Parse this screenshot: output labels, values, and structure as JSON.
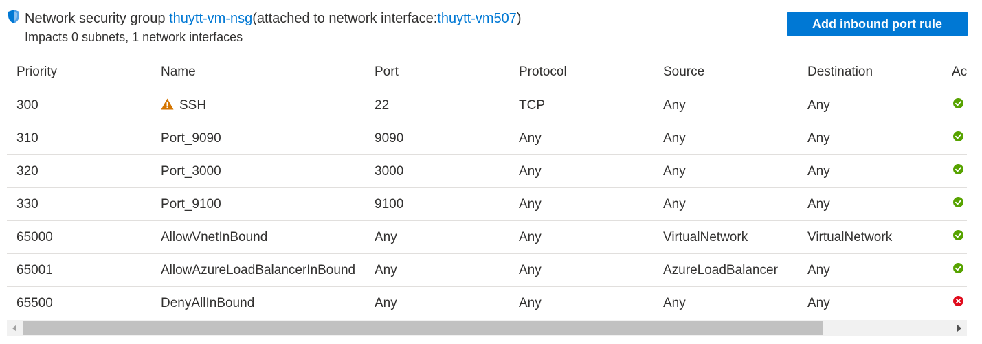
{
  "nsg": {
    "prefix": "Network security group ",
    "name": "thuytt-vm-nsg",
    "attached_prefix": " (attached to network interface: ",
    "interface": "thuytt-vm507",
    "attached_suffix": ")",
    "impacts": "Impacts 0 subnets, 1 network interfaces"
  },
  "add_button_label": "Add inbound port rule",
  "columns": [
    "Priority",
    "Name",
    "Port",
    "Protocol",
    "Source",
    "Destination",
    "Ac"
  ],
  "rules": [
    {
      "priority": "300",
      "name": "SSH",
      "warning": true,
      "port": "22",
      "protocol": "TCP",
      "source": "Any",
      "destination": "Any",
      "action": "allow"
    },
    {
      "priority": "310",
      "name": "Port_9090",
      "warning": false,
      "port": "9090",
      "protocol": "Any",
      "source": "Any",
      "destination": "Any",
      "action": "allow"
    },
    {
      "priority": "320",
      "name": "Port_3000",
      "warning": false,
      "port": "3000",
      "protocol": "Any",
      "source": "Any",
      "destination": "Any",
      "action": "allow"
    },
    {
      "priority": "330",
      "name": "Port_9100",
      "warning": false,
      "port": "9100",
      "protocol": "Any",
      "source": "Any",
      "destination": "Any",
      "action": "allow"
    },
    {
      "priority": "65000",
      "name": "AllowVnetInBound",
      "warning": false,
      "port": "Any",
      "protocol": "Any",
      "source": "VirtualNetwork",
      "destination": "VirtualNetwork",
      "action": "allow"
    },
    {
      "priority": "65001",
      "name": "AllowAzureLoadBalancerInBound",
      "warning": false,
      "port": "Any",
      "protocol": "Any",
      "source": "AzureLoadBalancer",
      "destination": "Any",
      "action": "allow"
    },
    {
      "priority": "65500",
      "name": "DenyAllInBound",
      "warning": false,
      "port": "Any",
      "protocol": "Any",
      "source": "Any",
      "destination": "Any",
      "action": "deny"
    }
  ],
  "icons": {
    "shield": "shield-icon",
    "warning": "warning-icon",
    "allow": "check-circle-icon",
    "deny": "x-circle-icon"
  },
  "colors": {
    "accent": "#0078d4",
    "allow": "#57a300",
    "deny": "#e00b1c",
    "warning": "#d47500",
    "border": "#e1dfdd"
  }
}
